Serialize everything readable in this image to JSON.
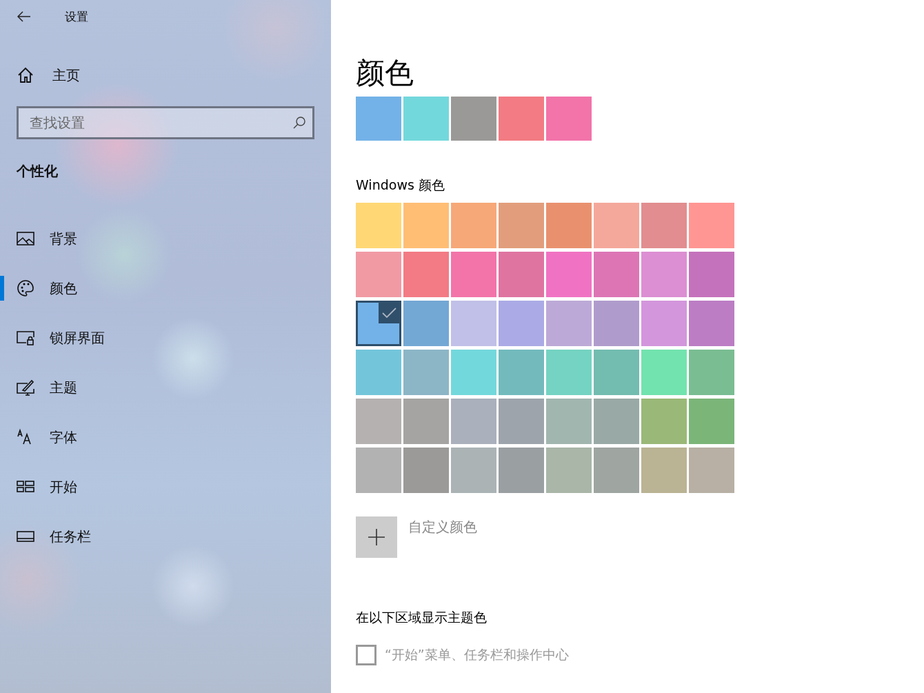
{
  "window": {
    "title": "设置"
  },
  "sidebar": {
    "home": "主页",
    "search": {
      "placeholder": "查找设置"
    },
    "section": "个性化",
    "items": [
      {
        "label": "背景",
        "kind": "picture",
        "selected": false
      },
      {
        "label": "颜色",
        "kind": "palette",
        "selected": true
      },
      {
        "label": "锁屏界面",
        "kind": "lock",
        "selected": false
      },
      {
        "label": "主题",
        "kind": "brush",
        "selected": false
      },
      {
        "label": "字体",
        "kind": "font",
        "selected": false
      },
      {
        "label": "开始",
        "kind": "start",
        "selected": false
      },
      {
        "label": "任务栏",
        "kind": "taskbar",
        "selected": false
      }
    ]
  },
  "content": {
    "title": "颜色",
    "recent_colors": [
      {
        "color": "#73b2e8"
      },
      {
        "color": "#73d8dc"
      },
      {
        "color": "#9a9997"
      },
      {
        "color": "#f37b83"
      },
      {
        "color": "#f274a9"
      }
    ],
    "windows_colors_heading": "Windows 颜色",
    "windows_colors": [
      {
        "color": "#ffd775",
        "selected": false
      },
      {
        "color": "#ffbe74",
        "selected": false
      },
      {
        "color": "#f7a878",
        "selected": false
      },
      {
        "color": "#e29e7c",
        "selected": false
      },
      {
        "color": "#e9916f",
        "selected": false
      },
      {
        "color": "#f4a89b",
        "selected": false
      },
      {
        "color": "#e28d8f",
        "selected": false
      },
      {
        "color": "#ff9693",
        "selected": false
      },
      {
        "color": "#f19aa4",
        "selected": false
      },
      {
        "color": "#f27b85",
        "selected": false
      },
      {
        "color": "#f274a9",
        "selected": false
      },
      {
        "color": "#df74a1",
        "selected": false
      },
      {
        "color": "#f073c3",
        "selected": false
      },
      {
        "color": "#dd75b5",
        "selected": false
      },
      {
        "color": "#dc8fd3",
        "selected": false
      },
      {
        "color": "#c572bc",
        "selected": false
      },
      {
        "color": "#73b2e8",
        "selected": true
      },
      {
        "color": "#73a8d4",
        "selected": false
      },
      {
        "color": "#c0c0e8",
        "selected": false
      },
      {
        "color": "#abaae6",
        "selected": false
      },
      {
        "color": "#bda9d7",
        "selected": false
      },
      {
        "color": "#b09ccc",
        "selected": false
      },
      {
        "color": "#d396dc",
        "selected": false
      },
      {
        "color": "#bc7dc4",
        "selected": false
      },
      {
        "color": "#73c6da",
        "selected": false
      },
      {
        "color": "#8cb6c6",
        "selected": false
      },
      {
        "color": "#73d8dc",
        "selected": false
      },
      {
        "color": "#73babd",
        "selected": false
      },
      {
        "color": "#74d3c2",
        "selected": false
      },
      {
        "color": "#73bcb0",
        "selected": false
      },
      {
        "color": "#72e3ae",
        "selected": false
      },
      {
        "color": "#7abd93",
        "selected": false
      },
      {
        "color": "#b5b1b0",
        "selected": false
      },
      {
        "color": "#a6a4a2",
        "selected": false
      },
      {
        "color": "#aab0bc",
        "selected": false
      },
      {
        "color": "#9ea4ac",
        "selected": false
      },
      {
        "color": "#a2b6b0",
        "selected": false
      },
      {
        "color": "#99aaa6",
        "selected": false
      },
      {
        "color": "#9ab877",
        "selected": false
      },
      {
        "color": "#7bb578",
        "selected": false
      },
      {
        "color": "#b2b2b2",
        "selected": false
      },
      {
        "color": "#9c9a98",
        "selected": false
      },
      {
        "color": "#abb3b5",
        "selected": false
      },
      {
        "color": "#9a9fa2",
        "selected": false
      },
      {
        "color": "#a9b6a8",
        "selected": false
      },
      {
        "color": "#9fa5a1",
        "selected": false
      },
      {
        "color": "#bab394",
        "selected": false
      },
      {
        "color": "#b8b0a4",
        "selected": false
      }
    ],
    "custom_color": "自定义颜色",
    "accent_heading": "在以下区域显示主题色",
    "checkboxes": [
      {
        "label": "“开始”菜单、任务栏和操作中心",
        "checked": false,
        "disabled": true
      }
    ]
  }
}
